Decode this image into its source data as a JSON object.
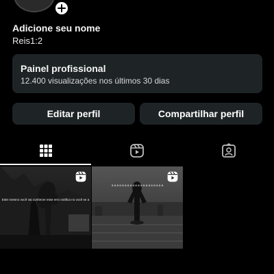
{
  "profile": {
    "name": "Adicione seu nome",
    "username": "Reis1:2"
  },
  "professional_panel": {
    "title": "Painel profissional",
    "subtitle": "12.400 visualizações nos últimos 30 dias"
  },
  "buttons": {
    "edit": "Editar perfil",
    "share": "Compartilhar perfil"
  },
  "tabs": [
    {
      "icon": "grid-icon",
      "active": true
    },
    {
      "icon": "reels-icon",
      "active": false
    },
    {
      "icon": "tagged-icon",
      "active": false
    }
  ],
  "posts": [
    {
      "type": "reel",
      "text": "Este mesmo você vai conhecer esse erro notifica no você se a"
    },
    {
      "type": "reel",
      "text": "a a a a a a a a a a a a a a a a a a a a"
    }
  ]
}
